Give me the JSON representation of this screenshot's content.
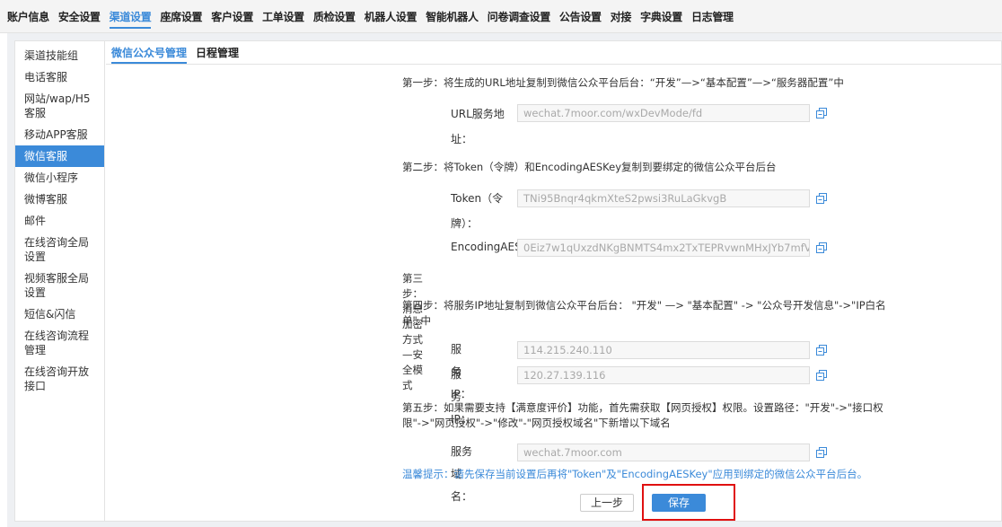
{
  "nav": {
    "tabs": [
      "账户信息",
      "安全设置",
      "渠道设置",
      "座席设置",
      "客户设置",
      "工单设置",
      "质检设置",
      "机器人设置",
      "智能机器人",
      "问卷调查设置",
      "公告设置",
      "对接",
      "字典设置",
      "日志管理"
    ],
    "active": "渠道设置"
  },
  "sidebar": {
    "items": [
      "渠道技能组",
      "电话客服",
      "网站/wap/H5客服",
      "移动APP客服",
      "微信客服",
      "微信小程序",
      "微博客服",
      "邮件",
      "在线咨询全局设置",
      "视频客服全局设置",
      "短信&闪信",
      "在线咨询流程管理",
      "在线咨询开放接口"
    ],
    "active": "微信客服"
  },
  "subtabs": {
    "items": [
      "微信公众号管理",
      "日程管理"
    ],
    "active": "微信公众号管理"
  },
  "step1": "第一步：将生成的URL地址复制到微信公众平台后台：“开发”—>“基本配置”—>“服务器配置”中",
  "url_field": {
    "label": "URL服务地址：",
    "value": "wechat.7moor.com/wxDevMode/fd"
  },
  "step2": "第二步：将Token（令牌）和EncodingAESKey复制到要绑定的微信公众平台后台",
  "token_field": {
    "label": "Token（令牌）：",
    "value": "TNi95Bnqr4qkmXteS2pwsi3RuLaGkvgB"
  },
  "aes_field": {
    "label": "EncodingAES",
    "value": "0Eiz7w1qUxzdNKgBNMTS4mx2TxTEPRvwnMHxJYb7mfV"
  },
  "step3": "第三步：消息加密方式—安全模式",
  "step4": "第四步：将服务IP地址复制到微信公众平台后台： \"开发\" —> \"基本配置\" -> \"公众号开发信息\"->\"IP白名单\" 中",
  "ip_fields": [
    {
      "label": "服务IP：",
      "value": "114.215.240.110"
    },
    {
      "label": "服务IP：",
      "value": "120.27.139.116"
    }
  ],
  "step5": "第五步：如果需要支持【满意度评价】功能，首先需获取【网页授权】权限。设置路径：\"开发\"->\"接口权限\"->\"网页授权\"->\"修改\"-\"网页授权域名\"下新增以下域名",
  "domain_field": {
    "label": "服务域名：",
    "value": "wechat.7moor.com"
  },
  "hint": "温馨提示：请先保存当前设置后再将\"Token\"及\"EncodingAESKey\"应用到绑定的微信公众平台后台。",
  "buttons": {
    "prev": "上一步",
    "save": "保存"
  },
  "colors": {
    "accent": "#3b8ad9",
    "highlight": "#e01010"
  }
}
